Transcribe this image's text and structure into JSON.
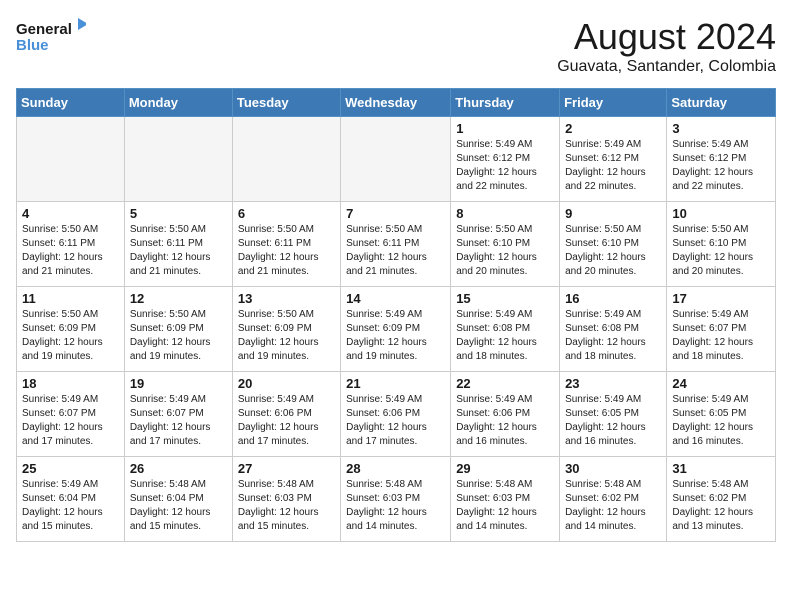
{
  "header": {
    "logo_line1": "General",
    "logo_line2": "Blue",
    "month": "August 2024",
    "location": "Guavata, Santander, Colombia"
  },
  "weekdays": [
    "Sunday",
    "Monday",
    "Tuesday",
    "Wednesday",
    "Thursday",
    "Friday",
    "Saturday"
  ],
  "weeks": [
    [
      {
        "day": "",
        "info": ""
      },
      {
        "day": "",
        "info": ""
      },
      {
        "day": "",
        "info": ""
      },
      {
        "day": "",
        "info": ""
      },
      {
        "day": "1",
        "info": "Sunrise: 5:49 AM\nSunset: 6:12 PM\nDaylight: 12 hours\nand 22 minutes."
      },
      {
        "day": "2",
        "info": "Sunrise: 5:49 AM\nSunset: 6:12 PM\nDaylight: 12 hours\nand 22 minutes."
      },
      {
        "day": "3",
        "info": "Sunrise: 5:49 AM\nSunset: 6:12 PM\nDaylight: 12 hours\nand 22 minutes."
      }
    ],
    [
      {
        "day": "4",
        "info": "Sunrise: 5:50 AM\nSunset: 6:11 PM\nDaylight: 12 hours\nand 21 minutes."
      },
      {
        "day": "5",
        "info": "Sunrise: 5:50 AM\nSunset: 6:11 PM\nDaylight: 12 hours\nand 21 minutes."
      },
      {
        "day": "6",
        "info": "Sunrise: 5:50 AM\nSunset: 6:11 PM\nDaylight: 12 hours\nand 21 minutes."
      },
      {
        "day": "7",
        "info": "Sunrise: 5:50 AM\nSunset: 6:11 PM\nDaylight: 12 hours\nand 21 minutes."
      },
      {
        "day": "8",
        "info": "Sunrise: 5:50 AM\nSunset: 6:10 PM\nDaylight: 12 hours\nand 20 minutes."
      },
      {
        "day": "9",
        "info": "Sunrise: 5:50 AM\nSunset: 6:10 PM\nDaylight: 12 hours\nand 20 minutes."
      },
      {
        "day": "10",
        "info": "Sunrise: 5:50 AM\nSunset: 6:10 PM\nDaylight: 12 hours\nand 20 minutes."
      }
    ],
    [
      {
        "day": "11",
        "info": "Sunrise: 5:50 AM\nSunset: 6:09 PM\nDaylight: 12 hours\nand 19 minutes."
      },
      {
        "day": "12",
        "info": "Sunrise: 5:50 AM\nSunset: 6:09 PM\nDaylight: 12 hours\nand 19 minutes."
      },
      {
        "day": "13",
        "info": "Sunrise: 5:50 AM\nSunset: 6:09 PM\nDaylight: 12 hours\nand 19 minutes."
      },
      {
        "day": "14",
        "info": "Sunrise: 5:49 AM\nSunset: 6:09 PM\nDaylight: 12 hours\nand 19 minutes."
      },
      {
        "day": "15",
        "info": "Sunrise: 5:49 AM\nSunset: 6:08 PM\nDaylight: 12 hours\nand 18 minutes."
      },
      {
        "day": "16",
        "info": "Sunrise: 5:49 AM\nSunset: 6:08 PM\nDaylight: 12 hours\nand 18 minutes."
      },
      {
        "day": "17",
        "info": "Sunrise: 5:49 AM\nSunset: 6:07 PM\nDaylight: 12 hours\nand 18 minutes."
      }
    ],
    [
      {
        "day": "18",
        "info": "Sunrise: 5:49 AM\nSunset: 6:07 PM\nDaylight: 12 hours\nand 17 minutes."
      },
      {
        "day": "19",
        "info": "Sunrise: 5:49 AM\nSunset: 6:07 PM\nDaylight: 12 hours\nand 17 minutes."
      },
      {
        "day": "20",
        "info": "Sunrise: 5:49 AM\nSunset: 6:06 PM\nDaylight: 12 hours\nand 17 minutes."
      },
      {
        "day": "21",
        "info": "Sunrise: 5:49 AM\nSunset: 6:06 PM\nDaylight: 12 hours\nand 17 minutes."
      },
      {
        "day": "22",
        "info": "Sunrise: 5:49 AM\nSunset: 6:06 PM\nDaylight: 12 hours\nand 16 minutes."
      },
      {
        "day": "23",
        "info": "Sunrise: 5:49 AM\nSunset: 6:05 PM\nDaylight: 12 hours\nand 16 minutes."
      },
      {
        "day": "24",
        "info": "Sunrise: 5:49 AM\nSunset: 6:05 PM\nDaylight: 12 hours\nand 16 minutes."
      }
    ],
    [
      {
        "day": "25",
        "info": "Sunrise: 5:49 AM\nSunset: 6:04 PM\nDaylight: 12 hours\nand 15 minutes."
      },
      {
        "day": "26",
        "info": "Sunrise: 5:48 AM\nSunset: 6:04 PM\nDaylight: 12 hours\nand 15 minutes."
      },
      {
        "day": "27",
        "info": "Sunrise: 5:48 AM\nSunset: 6:03 PM\nDaylight: 12 hours\nand 15 minutes."
      },
      {
        "day": "28",
        "info": "Sunrise: 5:48 AM\nSunset: 6:03 PM\nDaylight: 12 hours\nand 14 minutes."
      },
      {
        "day": "29",
        "info": "Sunrise: 5:48 AM\nSunset: 6:03 PM\nDaylight: 12 hours\nand 14 minutes."
      },
      {
        "day": "30",
        "info": "Sunrise: 5:48 AM\nSunset: 6:02 PM\nDaylight: 12 hours\nand 14 minutes."
      },
      {
        "day": "31",
        "info": "Sunrise: 5:48 AM\nSunset: 6:02 PM\nDaylight: 12 hours\nand 13 minutes."
      }
    ]
  ]
}
